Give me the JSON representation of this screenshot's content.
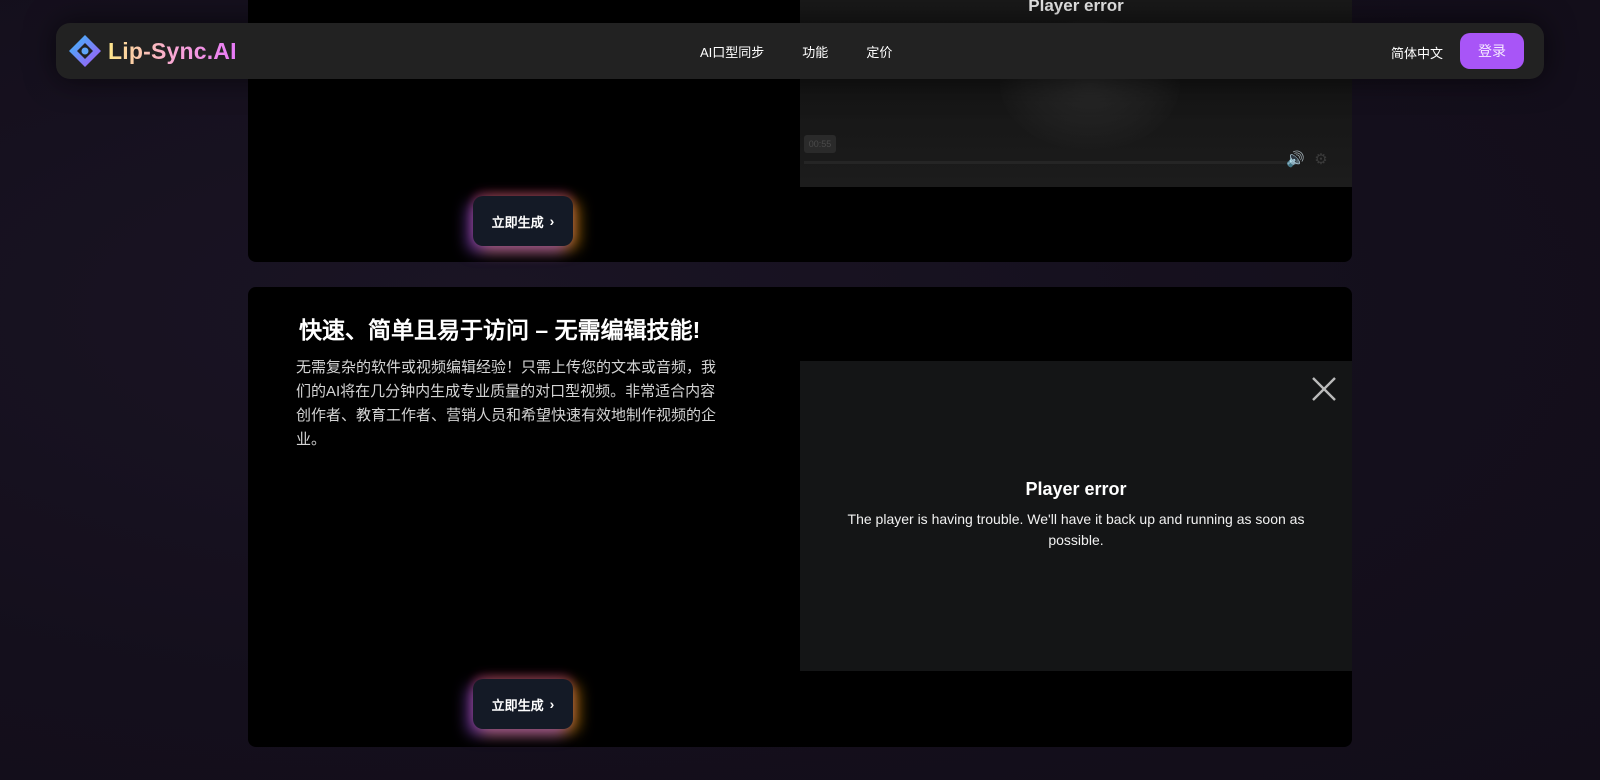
{
  "header": {
    "logo_text": "Lip-Sync.AI",
    "nav": [
      "AI口型同步",
      "功能",
      "定价"
    ],
    "language": "简体中文",
    "login_label": "登录"
  },
  "card1": {
    "player_title": "Player error",
    "player_time": "00:55",
    "generate_label": "立即生成"
  },
  "card2": {
    "heading": "快速、简单且易于访问 – 无需编辑技能!",
    "paragraph": "无需复杂的软件或视频编辑经验！只需上传您的文本或音频，我们的AI将在几分钟内生成专业质量的对口型视频。非常适合内容创作者、教育工作者、营销人员和希望快速有效地制作视频的企业。",
    "player_title": "Player error",
    "player_message": "The player is having trouble. We'll have it back up and running as soon as possible.",
    "generate_label": "立即生成"
  },
  "colors": {
    "accent": "#a855f7",
    "card_bg": "#000000",
    "header_bg": "#222222"
  }
}
